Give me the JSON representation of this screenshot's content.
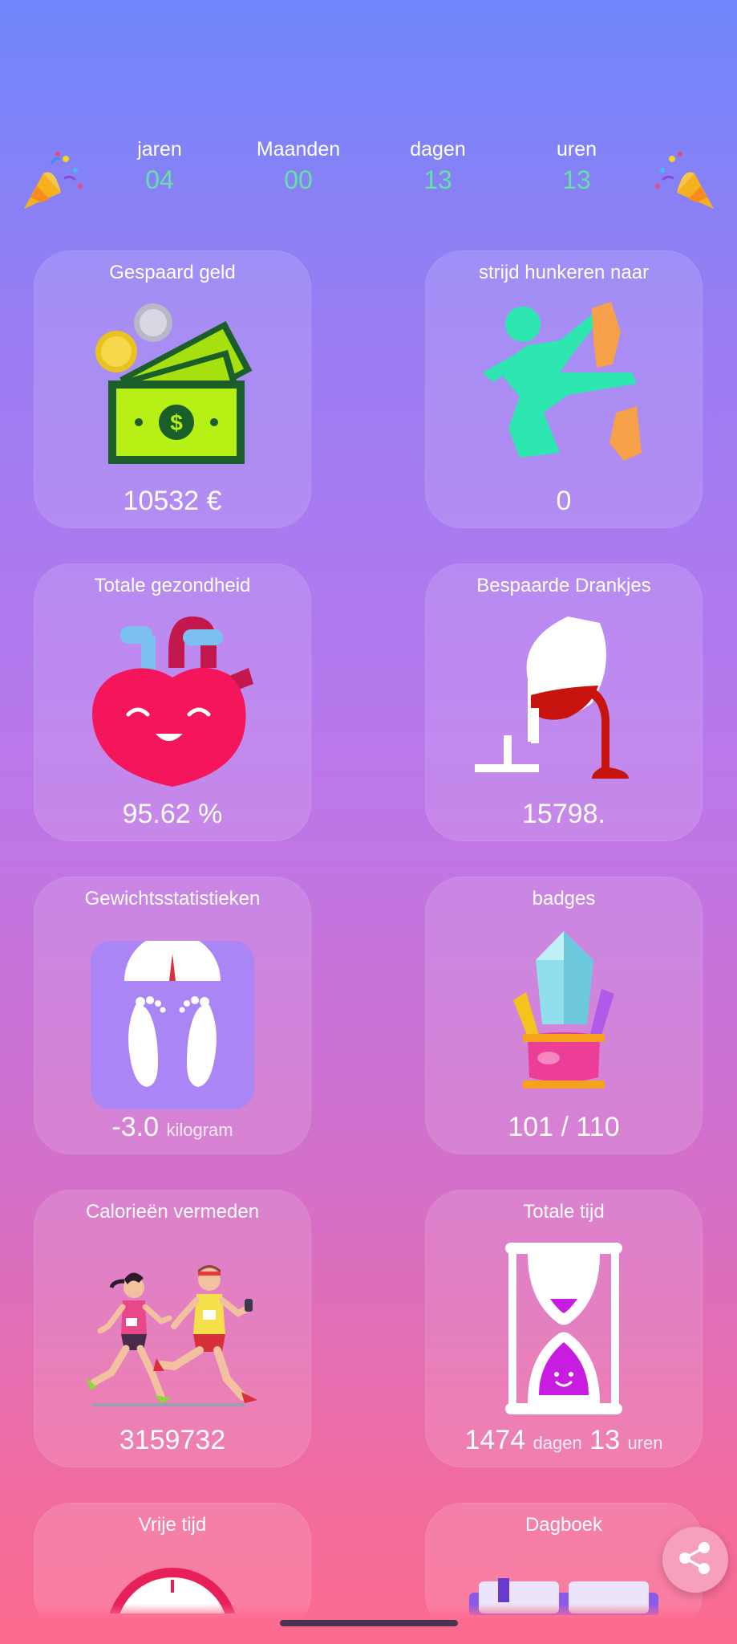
{
  "counters": [
    {
      "label": "jaren",
      "value": "04"
    },
    {
      "label": "Maanden",
      "value": "00"
    },
    {
      "label": "dagen",
      "value": "13"
    },
    {
      "label": "uren",
      "value": "13"
    }
  ],
  "cards": {
    "saved_money": {
      "title": "Gespaard geld",
      "value": "10532 €"
    },
    "cravings": {
      "title": "strijd hunkeren naar",
      "value": "0"
    },
    "health": {
      "title": "Totale gezondheid",
      "value": "95.62 %"
    },
    "drinks": {
      "title": "Bespaarde Drankjes",
      "value": "15798."
    },
    "weight": {
      "title": "Gewichtsstatistieken",
      "value": "-3.0",
      "unit": "kilogram"
    },
    "badges": {
      "title": "badges",
      "value": "101 / 110"
    },
    "calories": {
      "title": "Calorieën vermeden",
      "value": "3159732"
    },
    "total_time": {
      "title": "Totale tijd",
      "days": "1474",
      "days_unit": "dagen",
      "hours": "13",
      "hours_unit": "uren"
    },
    "free_time": {
      "title": "Vrije tijd"
    },
    "diary": {
      "title": "Dagboek"
    }
  },
  "icons": {
    "party": "party-popper-icon",
    "money": "money-icon",
    "karate": "karate-kick-icon",
    "heart": "heart-icon",
    "wine": "wine-glass-icon",
    "scale": "scale-footprints-icon",
    "trophy": "crystal-trophy-icon",
    "runners": "runners-icon",
    "hourglass": "hourglass-icon",
    "clock": "clock-icon",
    "book": "book-icon",
    "share": "share-icon"
  },
  "colors": {
    "counter_value": "#67e0a7"
  }
}
